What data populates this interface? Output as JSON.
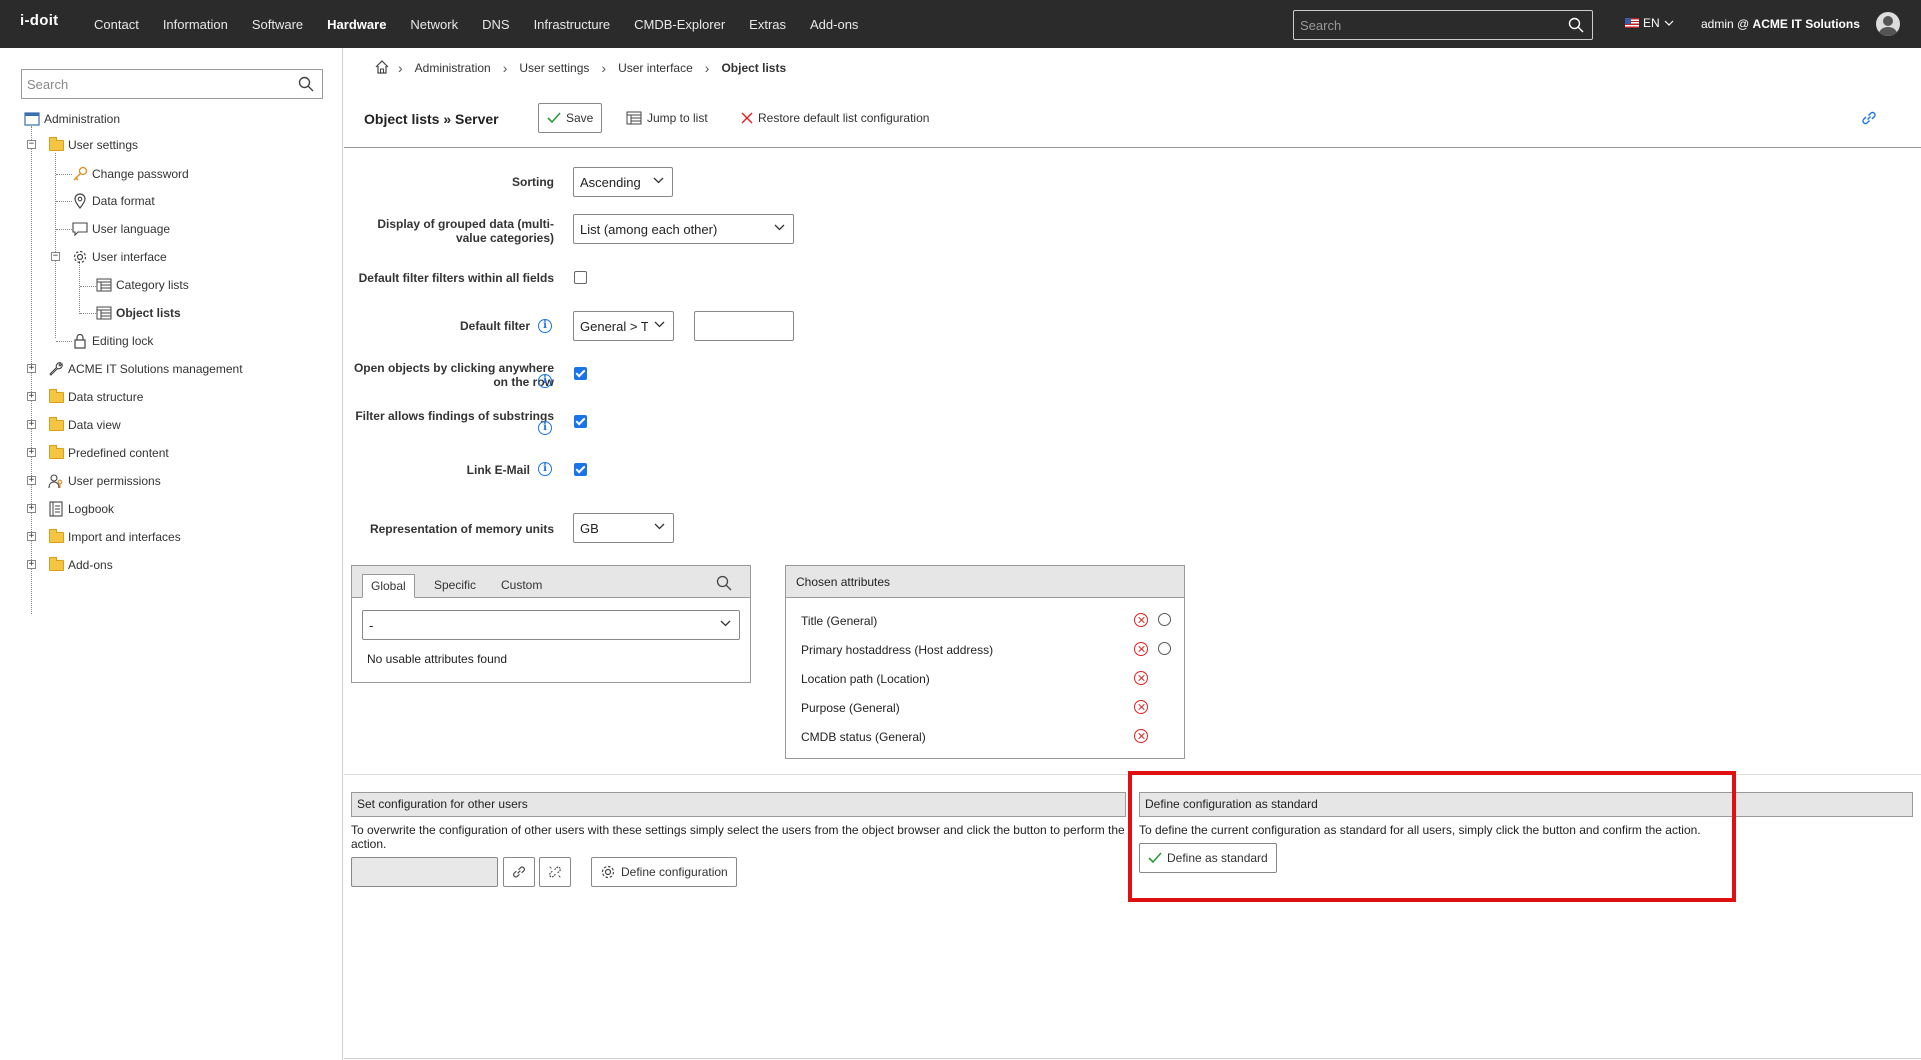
{
  "topbar": {
    "logo": "i-doit",
    "nav": [
      "Contact",
      "Information",
      "Software",
      "Hardware",
      "Network",
      "DNS",
      "Infrastructure",
      "CMDB-Explorer",
      "Extras",
      "Add-ons"
    ],
    "active_nav": "Hardware",
    "search_placeholder": "Search",
    "language": "EN",
    "user_prefix": "admin @",
    "tenant": "ACME IT Solutions"
  },
  "sidebar": {
    "search_placeholder": "Search",
    "root": "Administration",
    "items": {
      "user_settings": "User settings",
      "change_password": "Change password",
      "data_format": "Data format",
      "user_language": "User language",
      "user_interface": "User interface",
      "category_lists": "Category lists",
      "object_lists": "Object lists",
      "editing_lock": "Editing lock",
      "acme_mgmt": "ACME IT Solutions management",
      "data_structure": "Data structure",
      "data_view": "Data view",
      "predefined_content": "Predefined content",
      "user_permissions": "User permissions",
      "logbook": "Logbook",
      "import_interfaces": "Import and interfaces",
      "addons": "Add-ons"
    }
  },
  "breadcrumb": [
    "Administration",
    "User settings",
    "User interface",
    "Object lists"
  ],
  "toolbar": {
    "title": "Object lists » Server",
    "save": "Save",
    "jump": "Jump to list",
    "restore": "Restore default list configuration"
  },
  "form": {
    "sorting_label": "Sorting",
    "sorting_value": "Ascending",
    "grouped_label": "Display of grouped data (multi-value categories)",
    "grouped_value": "List (among each other)",
    "default_filter_all_label": "Default filter filters within all fields",
    "default_filter_all_checked": false,
    "default_filter_label": "Default filter",
    "default_filter_value": "General > T",
    "default_filter_text": "",
    "open_objects_label": "Open objects by clicking anywhere on the row",
    "open_objects_checked": true,
    "substrings_label": "Filter allows findings of substrings",
    "substrings_checked": true,
    "link_email_label": "Link E-Mail",
    "link_email_checked": true,
    "memory_label": "Representation of memory units",
    "memory_value": "GB"
  },
  "attributes_panel": {
    "tabs": [
      "Global",
      "Specific",
      "Custom"
    ],
    "active_tab": "Global",
    "select_value": "-",
    "empty_text": "No usable attributes found"
  },
  "chosen_panel": {
    "title": "Chosen attributes",
    "items": [
      {
        "label": "Title (General)",
        "sortable": true
      },
      {
        "label": "Primary hostaddress (Host address)",
        "sortable": true
      },
      {
        "label": "Location path (Location)",
        "sortable": false
      },
      {
        "label": "Purpose (General)",
        "sortable": false
      },
      {
        "label": "CMDB status (General)",
        "sortable": false
      }
    ]
  },
  "other_users": {
    "title": "Set configuration for other users",
    "text": "To overwrite the configuration of other users with these settings simply select the users from the object browser and click the button to perform the action.",
    "button": "Define configuration"
  },
  "standard": {
    "title": "Define configuration as standard",
    "text": "To define the current configuration as standard for all users, simply click the button and confirm the action.",
    "button": "Define as standard"
  },
  "colors": {
    "topbar": "#2b2b2b",
    "accent": "#1a73e8",
    "highlight": "#e01010",
    "remove": "#e02020"
  }
}
